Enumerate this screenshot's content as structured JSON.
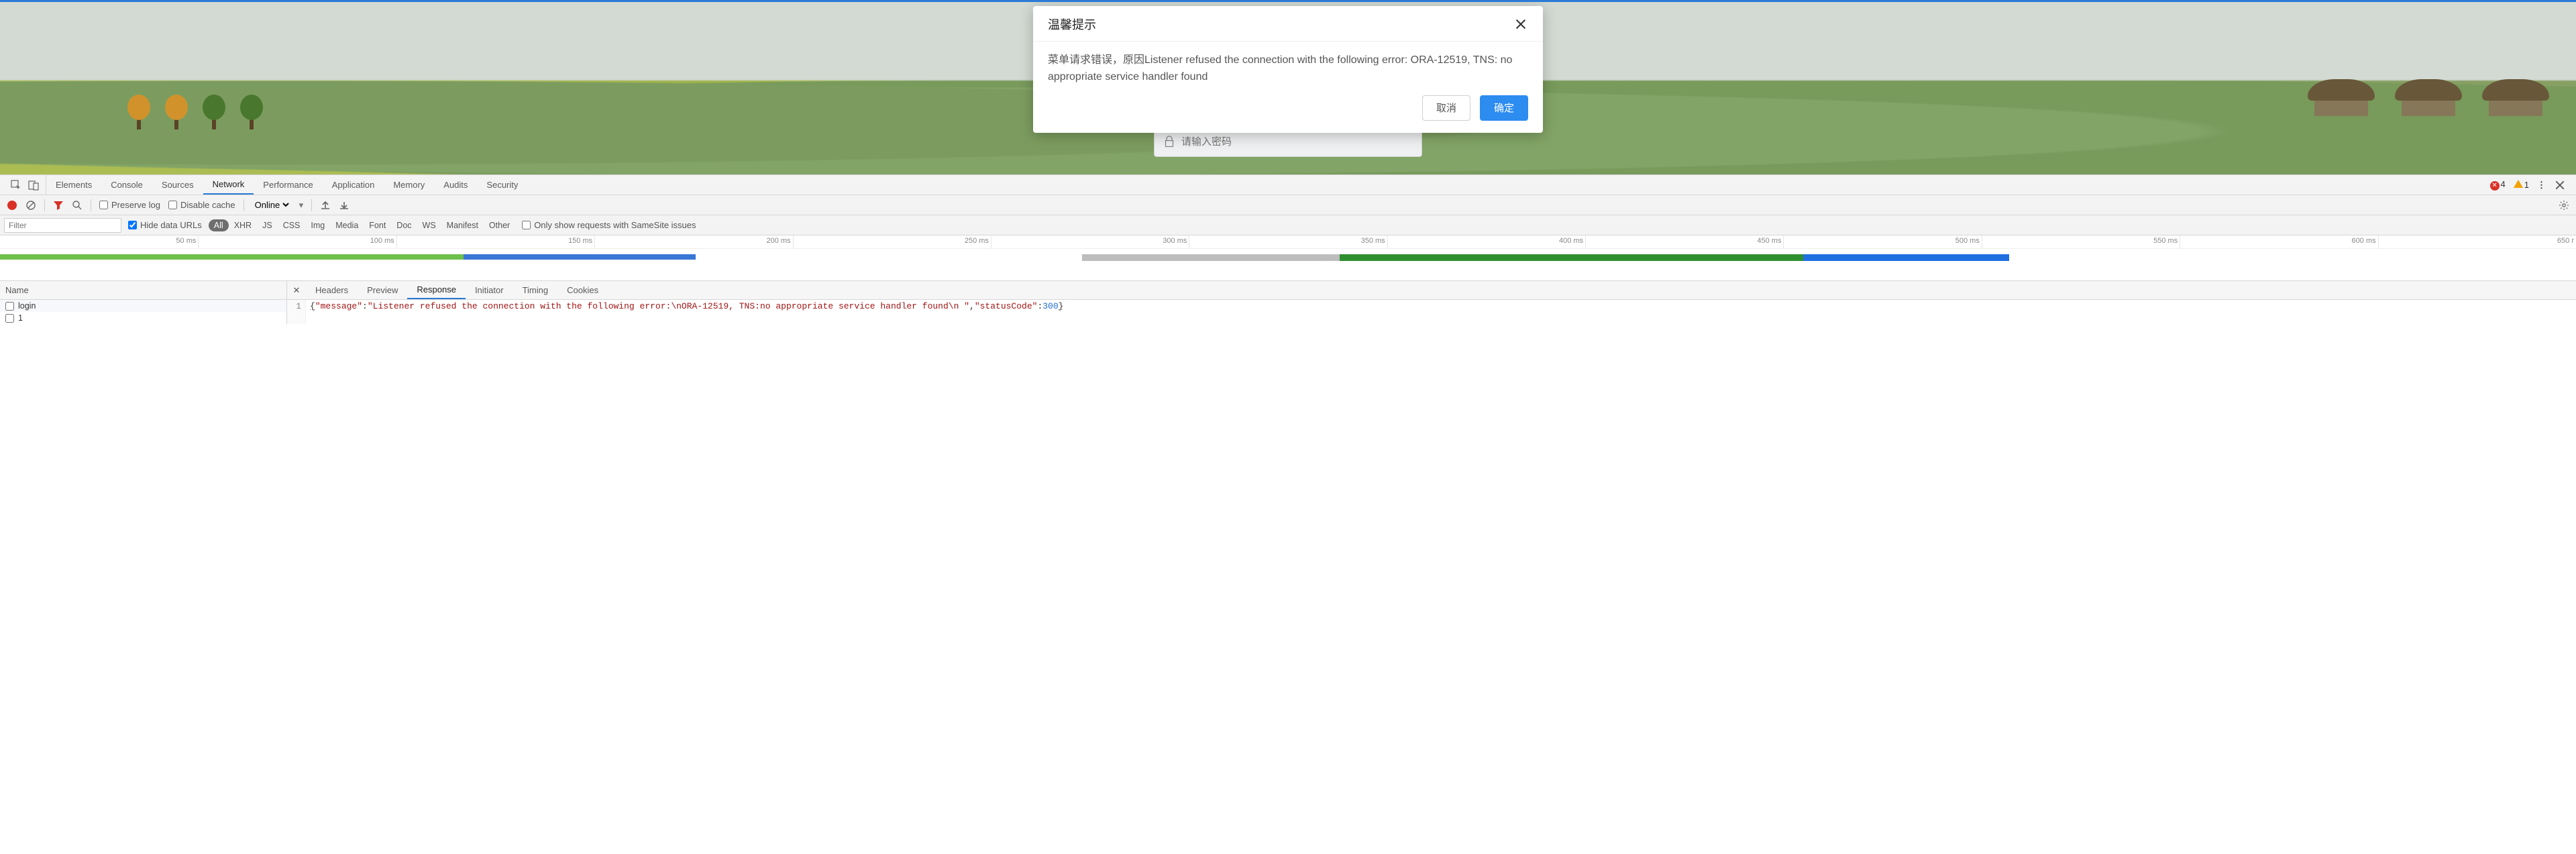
{
  "modal": {
    "title": "温馨提示",
    "body": "菜单请求错误，原因Listener refused the connection with the following error: ORA-12519, TNS: no appropriate service handler found",
    "cancel": "取消",
    "ok": "确定"
  },
  "page": {
    "password_placeholder": "请输入密码"
  },
  "devtools": {
    "tabs": [
      "Elements",
      "Console",
      "Sources",
      "Network",
      "Performance",
      "Application",
      "Memory",
      "Audits",
      "Security"
    ],
    "active_tab": "Network",
    "errors_count": "4",
    "warnings_count": "1",
    "toolbar": {
      "preserve_log": "Preserve log",
      "disable_cache": "Disable cache",
      "throttle": "Online"
    },
    "filter": {
      "placeholder": "Filter",
      "hide_data_urls": "Hide data URLs",
      "types": [
        "All",
        "XHR",
        "JS",
        "CSS",
        "Img",
        "Media",
        "Font",
        "Doc",
        "WS",
        "Manifest",
        "Other"
      ],
      "active_type": "All",
      "samesite": "Only show requests with SameSite issues"
    },
    "timeline": {
      "ticks": [
        "50 ms",
        "100 ms",
        "150 ms",
        "200 ms",
        "250 ms",
        "300 ms",
        "350 ms",
        "400 ms",
        "450 ms",
        "500 ms",
        "550 ms",
        "600 ms",
        "650 r"
      ]
    },
    "requests": {
      "header": "Name",
      "rows": [
        "login",
        "1"
      ]
    },
    "detail": {
      "tabs": [
        "Headers",
        "Preview",
        "Response",
        "Initiator",
        "Timing",
        "Cookies"
      ],
      "active": "Response",
      "line_no": "1",
      "json_message_key": "\"message\"",
      "json_message_val": "\"Listener refused the connection with the following error:\\nORA-12519, TNS:no appropriate service handler found\\n \"",
      "json_status_key": "\"statusCode\"",
      "json_status_val": "300"
    }
  }
}
